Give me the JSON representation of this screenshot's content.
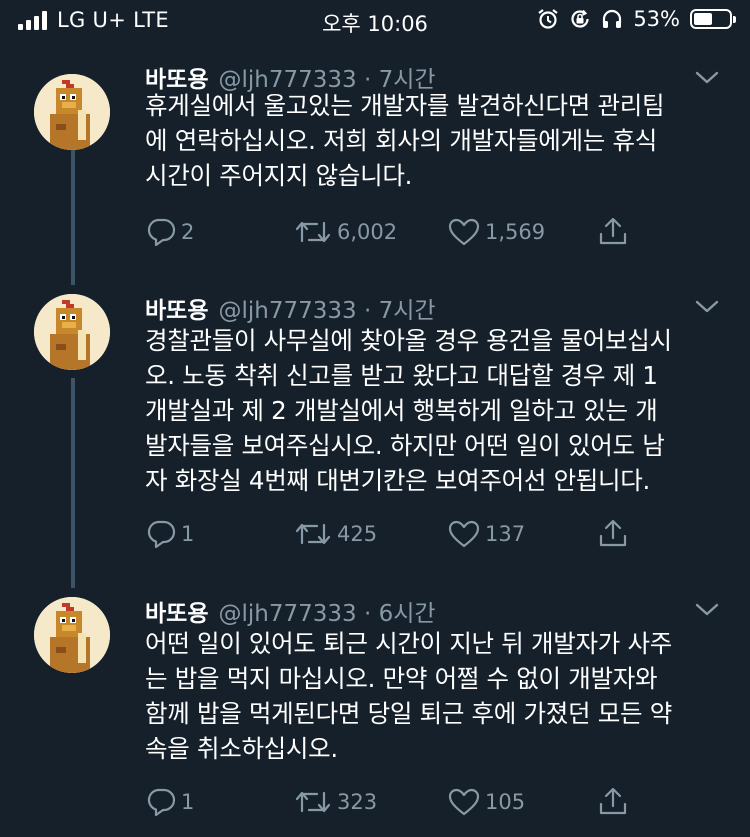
{
  "status_bar": {
    "carrier": "LG U+  LTE",
    "time": "오후 10:06",
    "battery_percent": "53%",
    "battery_level": 0.53
  },
  "tweets": [
    {
      "name": "바또용",
      "handle": "@ljh777333 · 7시간",
      "text": "휴게실에서 울고있는 개발자를 발견하신다면 관리팀\n에 연락하십시오. 저희 회사의 개발자들에게는 휴식\n시간이 주어지지 않습니다.",
      "replies": "2",
      "retweets": "6,002",
      "likes": "1,569"
    },
    {
      "name": "바또용",
      "handle": "@ljh777333 · 7시간",
      "text": "경찰관들이 사무실에 찾아올 경우 용건을 물어보십시\n오. 노동 착취 신고를 받고 왔다고 대답할 경우 제 1\n개발실과 제 2 개발실에서 행복하게 일하고 있는 개\n발자들을 보여주십시오. 하지만 어떤 일이 있어도 남\n자 화장실 4번째 대변기칸은 보여주어선 안됩니다.",
      "replies": "1",
      "retweets": "425",
      "likes": "137"
    },
    {
      "name": "바또용",
      "handle": "@ljh777333 · 6시간",
      "text": "어떤 일이 있어도 퇴근 시간이 지난 뒤 개발자가 사주\n는 밥을 먹지 마십시오. 만약 어쩔 수 없이 개발자와\n함께 밥을 먹게된다면 당일 퇴근 후에 가졌던 모든 약\n속을 취소하십시오.",
      "replies": "1",
      "retweets": "323",
      "likes": "105"
    }
  ],
  "icons": {
    "reply": "reply-icon",
    "retweet": "retweet-icon",
    "like": "heart-icon",
    "share": "share-icon",
    "more": "chevron-down-icon"
  },
  "colors": {
    "background": "#15202b",
    "secondary_text": "#8899a6",
    "thread_line": "#3d5466"
  }
}
